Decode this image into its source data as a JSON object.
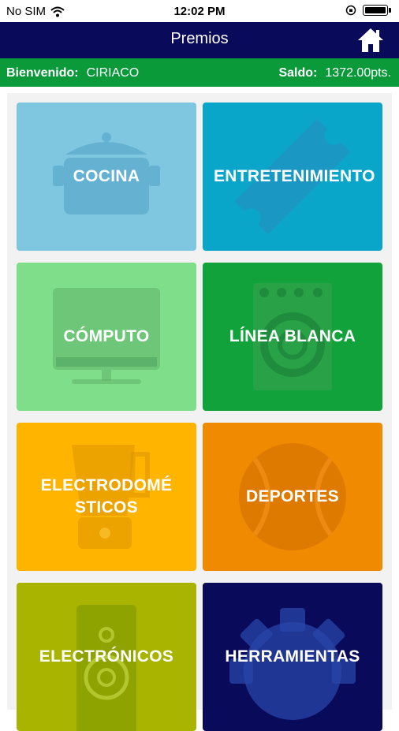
{
  "status_bar": {
    "carrier": "No SIM",
    "time": "12:02 PM"
  },
  "nav": {
    "title": "Premios",
    "home_icon": "home-icon"
  },
  "info": {
    "welcome_label": "Bienvenido:",
    "user_name": "CIRIACO",
    "balance_label": "Saldo:",
    "balance_value": "1372.00pts."
  },
  "categories": [
    {
      "label": "COCINA",
      "color": "#7fc7e0",
      "icon": "cooking-pot-icon"
    },
    {
      "label": "ENTRETENIMIENTO",
      "color": "#0aa6c9",
      "icon": "ticket-icon"
    },
    {
      "label": "CÓMPUTO",
      "color": "#7ede8a",
      "icon": "monitor-icon"
    },
    {
      "label": "LÍNEA BLANCA",
      "color": "#12a23c",
      "icon": "washing-machine-icon"
    },
    {
      "label": "ELECTRODOMÉ STICOS",
      "color": "#ffb400",
      "icon": "blender-icon"
    },
    {
      "label": "DEPORTES",
      "color": "#f08a00",
      "icon": "ball-icon"
    },
    {
      "label": "ELECTRÓNICOS",
      "color": "#a8b400",
      "icon": "speaker-icon"
    },
    {
      "label": "HERRAMIENTAS",
      "color": "#0a0a5a",
      "icon": "gear-icon"
    }
  ]
}
